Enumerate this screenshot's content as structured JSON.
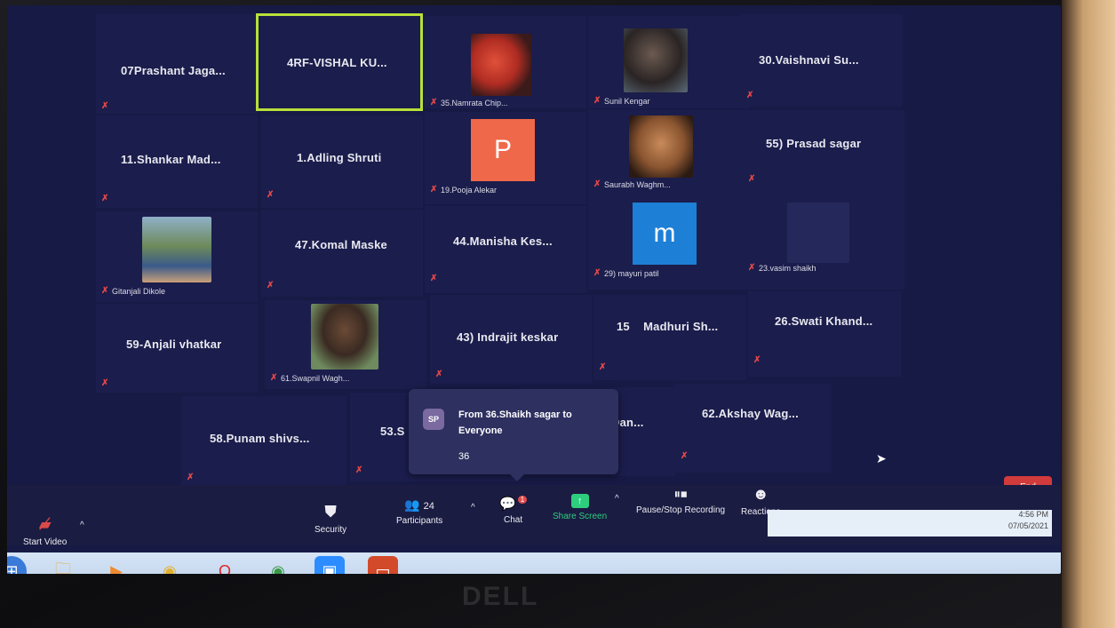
{
  "tiles": [
    {
      "name": "07Prashant Jaga..."
    },
    {
      "name": "4RF-VISHAL KU..."
    },
    {
      "label": "35.Namrata Chip..."
    },
    {
      "label": "Sunil Kengar"
    },
    {
      "name": "30.Vaishnavi Su..."
    },
    {
      "name": "11.Shankar Mad..."
    },
    {
      "name": "1.Adling Shruti"
    },
    {
      "label": "19.Pooja Alekar",
      "letter": "P"
    },
    {
      "label": "Saurabh Waghm..."
    },
    {
      "name": "55) Prasad sagar"
    },
    {
      "label": "Gitanjali Dikole"
    },
    {
      "name": "47.Komal Maske"
    },
    {
      "name": "44.Manisha Kes..."
    },
    {
      "label": "29) mayuri patil",
      "letter": "m"
    },
    {
      "label": "23.vasim shaikh"
    },
    {
      "name": "59-Anjali vhatkar"
    },
    {
      "label": "61.Swapnil Wagh..."
    },
    {
      "name": "43) Indrajit keskar"
    },
    {
      "name": "15    Madhuri Sh..."
    },
    {
      "name": "26.Swati Khand..."
    },
    {
      "name": "58.Punam shivs..."
    },
    {
      "name": "53.S"
    },
    {
      "name": "Dan..."
    },
    {
      "name": "62.Akshay Wag..."
    }
  ],
  "chat_toast": {
    "avatar": "SP",
    "line1": "From 36.Shaikh sagar to Everyone",
    "line2": "36"
  },
  "toolbar": {
    "start_video": "Start Video",
    "security": "Security",
    "participants": "Participants",
    "participants_count": "24",
    "chat": "Chat",
    "chat_badge": "1",
    "share_screen": "Share Screen",
    "recording": "Pause/Stop Recording",
    "reactions": "Reactions",
    "end": "End"
  },
  "clock": {
    "time": "4:56 PM",
    "date": "07/05/2021"
  },
  "brand": "DELL",
  "colors": {
    "tile_bg": "#1b1d4c",
    "active_border": "#b7e03a",
    "share_green": "#2dcf7e",
    "end_red": "#d23b3b"
  }
}
